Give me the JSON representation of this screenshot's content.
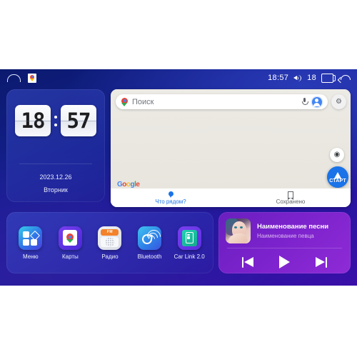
{
  "statusbar": {
    "home_icon": "home-icon",
    "maps_icon": "google-maps-icon",
    "time": "18:57",
    "volume_icon": "volume-icon",
    "volume_level": "18",
    "recents_icon": "recents-icon",
    "back_icon": "back-icon"
  },
  "clock": {
    "hours": "18",
    "minutes": "57",
    "date": "2023.12.26",
    "weekday": "Вторник"
  },
  "map": {
    "search_placeholder": "Поиск",
    "pin_icon": "map-pin-icon",
    "mic_icon": "microphone-icon",
    "avatar_icon": "account-avatar-icon",
    "gear_icon": "settings-gear-icon",
    "gear_glyph": "⚙",
    "locate_icon": "my-location-icon",
    "locate_glyph": "◉",
    "start_label": "СТАРТ",
    "brand": {
      "g1": "G",
      "o1": "o",
      "o2": "o",
      "g2": "g",
      "l": "l",
      "e": "e"
    },
    "tabs": [
      {
        "label": "Что рядом?",
        "icon": "place-pin-icon",
        "active": true
      },
      {
        "label": "Сохранено",
        "icon": "bookmark-icon",
        "active": false
      }
    ]
  },
  "dock": {
    "apps": [
      {
        "label": "Меню",
        "icon": "apps-grid-icon"
      },
      {
        "label": "Карты",
        "icon": "maps-app-icon"
      },
      {
        "label": "Радио",
        "icon": "fm-radio-icon",
        "band": "FM"
      },
      {
        "label": "Bluetooth",
        "icon": "bluetooth-phone-icon"
      },
      {
        "label": "Car Link 2.0",
        "icon": "car-link-icon"
      }
    ]
  },
  "music": {
    "album_art": "album-cover-portrait",
    "title": "Наименование песни",
    "artist": "Наименование певца",
    "controls": [
      {
        "name": "previous-track-button",
        "icon": "skip-previous-icon"
      },
      {
        "name": "play-button",
        "icon": "play-icon"
      },
      {
        "name": "next-track-button",
        "icon": "skip-next-icon"
      }
    ]
  },
  "colors": {
    "accent_blue": "#1a73e8",
    "bg_deep_blue": "#141f8f",
    "bg_purple": "#3a0fa8",
    "music_purple": "#7b22cc",
    "radio_orange": "#f3822a",
    "map_beige": "#eae7e0"
  }
}
